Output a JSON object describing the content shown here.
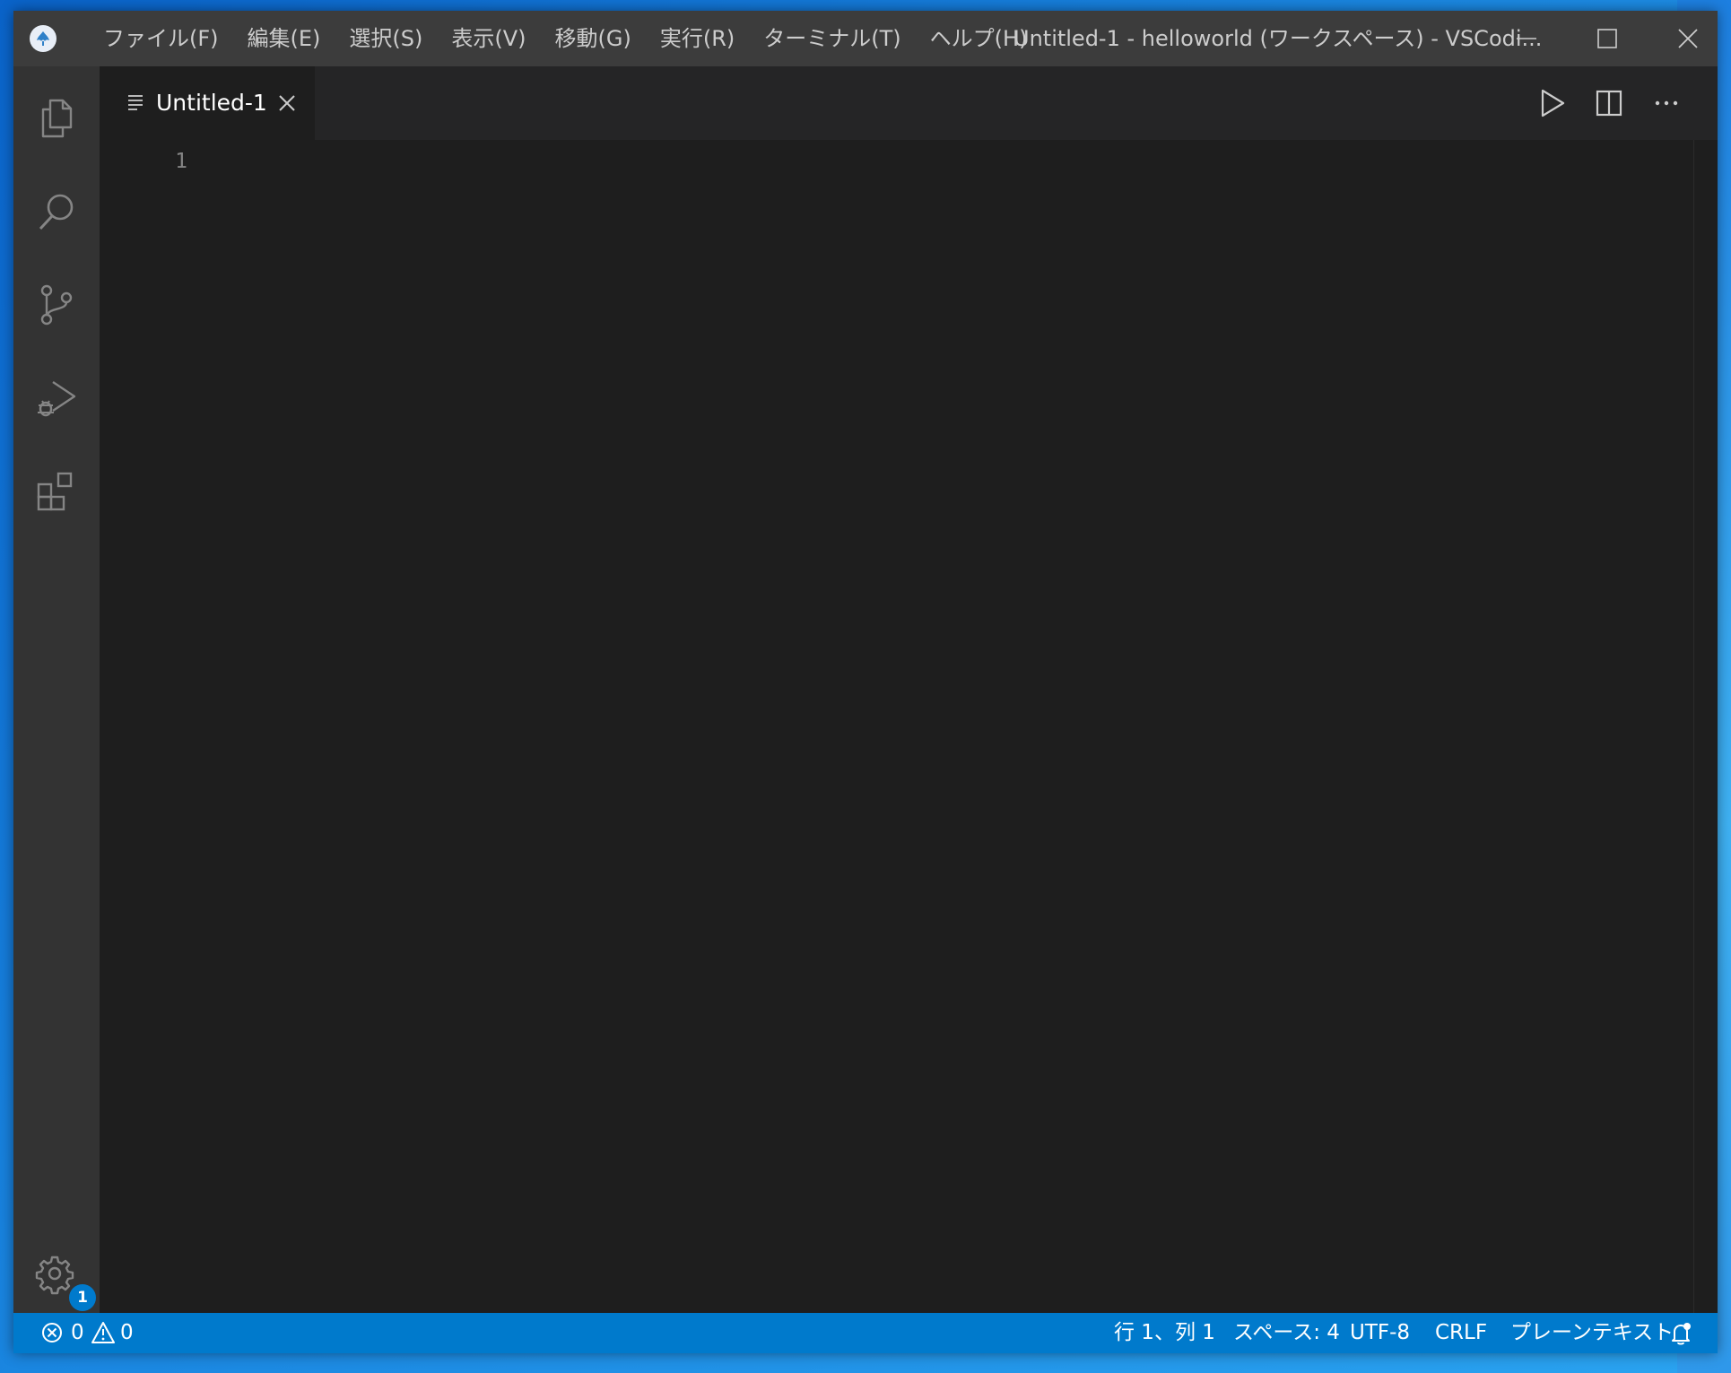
{
  "window": {
    "title": "Untitled-1 - helloworld (ワークスペース) - VSCodi...",
    "menus": [
      "ファイル(F)",
      "編集(E)",
      "選択(S)",
      "表示(V)",
      "移動(G)",
      "実行(R)",
      "ターミナル(T)",
      "ヘルプ(H)"
    ]
  },
  "activity": {
    "icons": [
      "explorer-icon",
      "search-icon",
      "source-control-icon",
      "run-debug-icon",
      "extensions-icon"
    ],
    "settings_badge": "1"
  },
  "editor": {
    "tab_label": "Untitled-1",
    "line_numbers": [
      "1"
    ]
  },
  "status": {
    "errors": "0",
    "warnings": "0",
    "cursor": "行 1、列 1",
    "indent": "スペース: 4",
    "encoding": "UTF-8",
    "eol": "CRLF",
    "language": "プレーンテキスト"
  },
  "colors": {
    "titlebar": "#3c3c3c",
    "activitybar": "#333333",
    "editor": "#1e1e1e",
    "statusbar": "#007acc",
    "desktop": "#1a86e0"
  }
}
